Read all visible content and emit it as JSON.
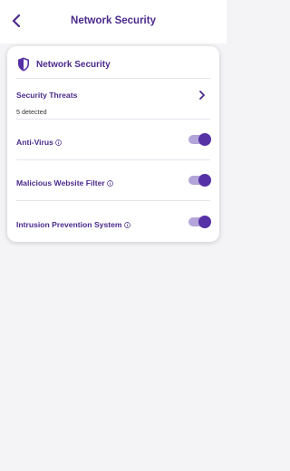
{
  "header": {
    "title": "Network Security",
    "back_icon": "chevron-left-icon"
  },
  "card": {
    "title": "Network Security",
    "title_icon": "shield-icon",
    "threats": {
      "label": "Security Threats",
      "detail": "5 detected",
      "icon": "chevron-right-icon"
    },
    "settings": [
      {
        "label": "Anti-Virus",
        "enabled": true
      },
      {
        "label": "Malicious Website Filter",
        "enabled": true
      },
      {
        "label": "Intrusion Prevention System",
        "enabled": true
      }
    ]
  },
  "colors": {
    "accent": "#5631a6",
    "accent_light": "#b3a4d9",
    "text": "#4a2a8c",
    "background": "#f4f4f6"
  }
}
